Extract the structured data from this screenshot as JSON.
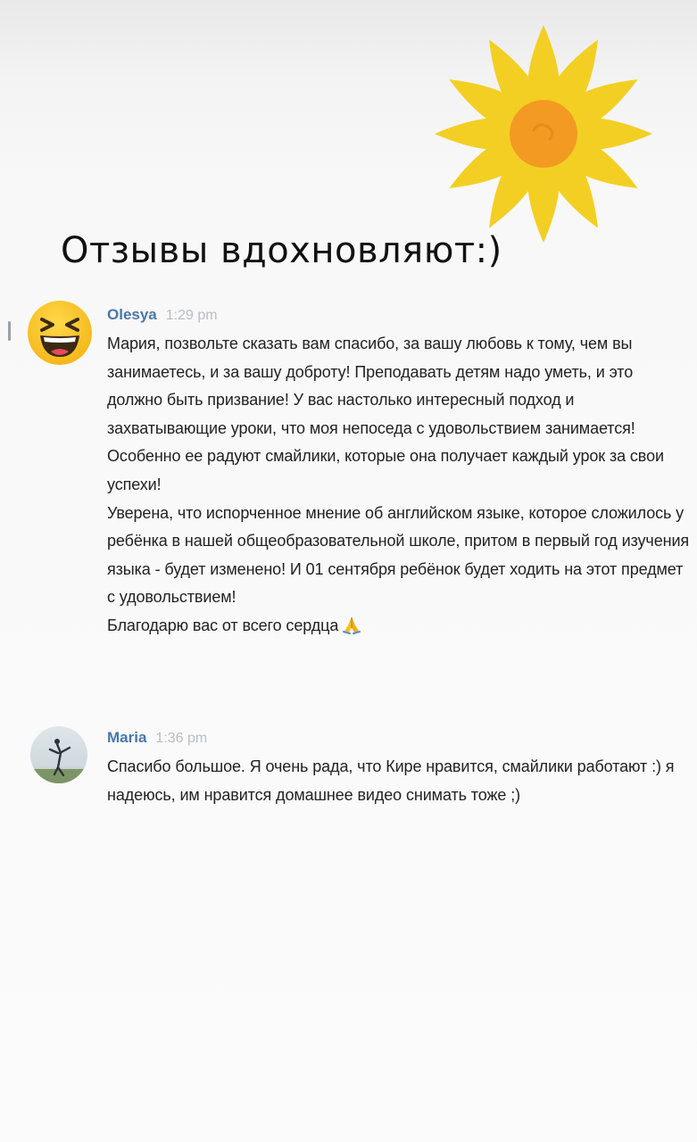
{
  "headline": "Отзывы вдохновляют:)",
  "messages": [
    {
      "author": "Olesya",
      "time": "1:29 pm",
      "avatar": "laughing-emoji-icon",
      "paragraphs": [
        "Мария, позвольте сказать вам спасибо, за вашу любовь к тому, чем вы занимаетесь, и за вашу доброту! Преподавать детям надо уметь, и это должно быть призвание! У вас настолько интересный подход и захватывающие уроки, что моя непоседа с удовольствием занимается! Особенно ее радуют смайлики, которые она получает каждый урок за свои успехи!",
        "Уверена, что испорченное мнение об английском языке, которое сложилось у ребёнка в нашей общеобразовательной школе, притом в первый год изучения языка - будет изменено! И 01 сентября ребёнок будет ходить на этот предмет с удовольствием!",
        "Благодарю вас от всего сердца"
      ],
      "trailing_icon": "praying-hands-icon"
    },
    {
      "author": "Maria",
      "time": "1:36 pm",
      "avatar": "photo-avatar",
      "paragraphs": [
        "Спасибо большое. Я очень рада, что Кире нравится, смайлики работают :) я надеюсь, им нравится домашнее видео снимать тоже ;)"
      ]
    }
  ],
  "colors": {
    "author": "#4a76a8",
    "time": "#b7bdc4",
    "sun_petals": "#f3cf24",
    "sun_center": "#f39a22"
  }
}
